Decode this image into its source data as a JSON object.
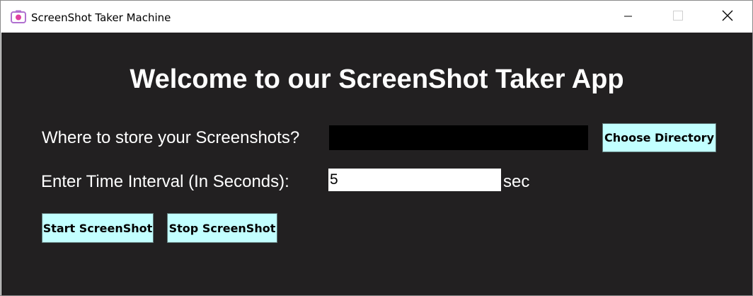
{
  "window": {
    "title": "ScreenShot Taker Machine",
    "icon": "camera-app-icon",
    "controls": {
      "minimize": "minimize-icon",
      "maximize": "maximize-icon",
      "close": "close-icon"
    }
  },
  "main": {
    "headline": "Welcome to our ScreenShot Taker App",
    "directory": {
      "label": "Where to store your Screenshots?",
      "value": "",
      "button_label": "Choose Directory"
    },
    "interval": {
      "label": "Enter Time Interval (In Seconds):",
      "value": "5",
      "unit": "sec"
    },
    "actions": {
      "start_label": "Start ScreenShot",
      "stop_label": "Stop ScreenShot"
    }
  },
  "colors": {
    "background": "#222021",
    "button_fill": "#c2ffff",
    "text": "#ffffff",
    "directory_field": "#000000"
  }
}
